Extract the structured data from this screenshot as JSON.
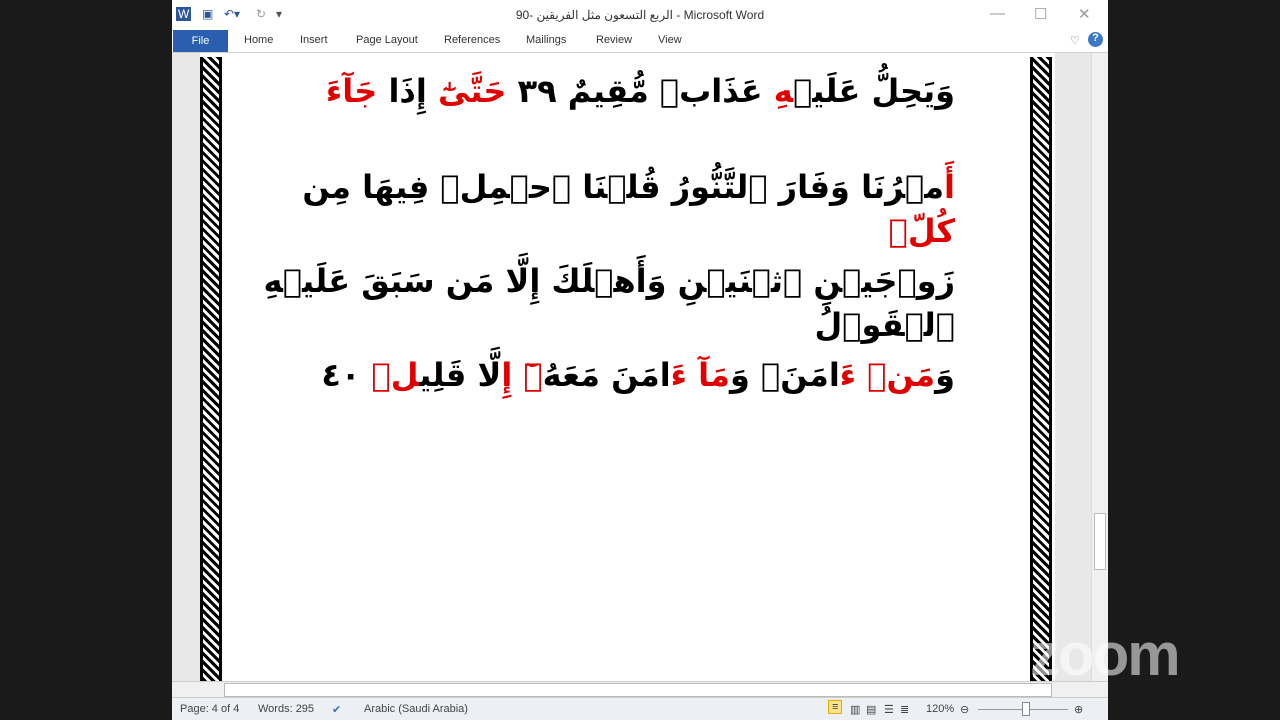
{
  "window": {
    "title": "الربع التسعون مثل الفريقين -90  -  Microsoft Word"
  },
  "ribbon": {
    "tabs": [
      "File",
      "Home",
      "Insert",
      "Page Layout",
      "References",
      "Mailings",
      "Review",
      "View"
    ]
  },
  "document": {
    "lines": [
      [
        {
          "t": "وَيَحِلُّ عَلَيۡ",
          "r": false
        },
        {
          "t": "هِ",
          "r": true
        },
        {
          "t": " عَذَابٞ مُّقِيمٌ ٣٩ ",
          "r": false
        },
        {
          "t": "حَتَّىٰٓ",
          "r": true
        },
        {
          "t": " إِذَا ",
          "r": false
        },
        {
          "t": "جَآءَ",
          "r": true
        }
      ],
      [
        {
          "t": "أَ",
          "r": true
        },
        {
          "t": "مۡرُنَا وَفَارَ ٱلتَّنُّورُ قُلۡنَا ٱحۡمِلۡ فِيهَا مِن ",
          "r": false
        },
        {
          "t": "كُلّٖ",
          "r": true
        }
      ],
      [
        {
          "t": "زَوۡجَيۡنِ ٱثۡنَيۡنِ وَأَهۡلَكَ إِلَّا مَن سَبَقَ عَلَيۡهِ ٱلۡقَوۡلُ",
          "r": false
        }
      ],
      [
        {
          "t": "وَ",
          "r": false
        },
        {
          "t": "مَنۡ ءَ",
          "r": true
        },
        {
          "t": "امَنَۚ وَ",
          "r": false
        },
        {
          "t": "مَآ ءَ",
          "r": true
        },
        {
          "t": "امَنَ مَعَهُ",
          "r": false
        },
        {
          "t": "ۥٓ إِ",
          "r": true
        },
        {
          "t": "لَّا قَلِي",
          "r": false
        },
        {
          "t": "لٞ",
          "r": true
        },
        {
          "t": " ٤٠",
          "r": false
        }
      ]
    ]
  },
  "status": {
    "page": "Page: 4 of 4",
    "words": "Words: 295",
    "language": "Arabic (Saudi Arabia)",
    "zoom": "120%"
  },
  "watermark": "zoom"
}
